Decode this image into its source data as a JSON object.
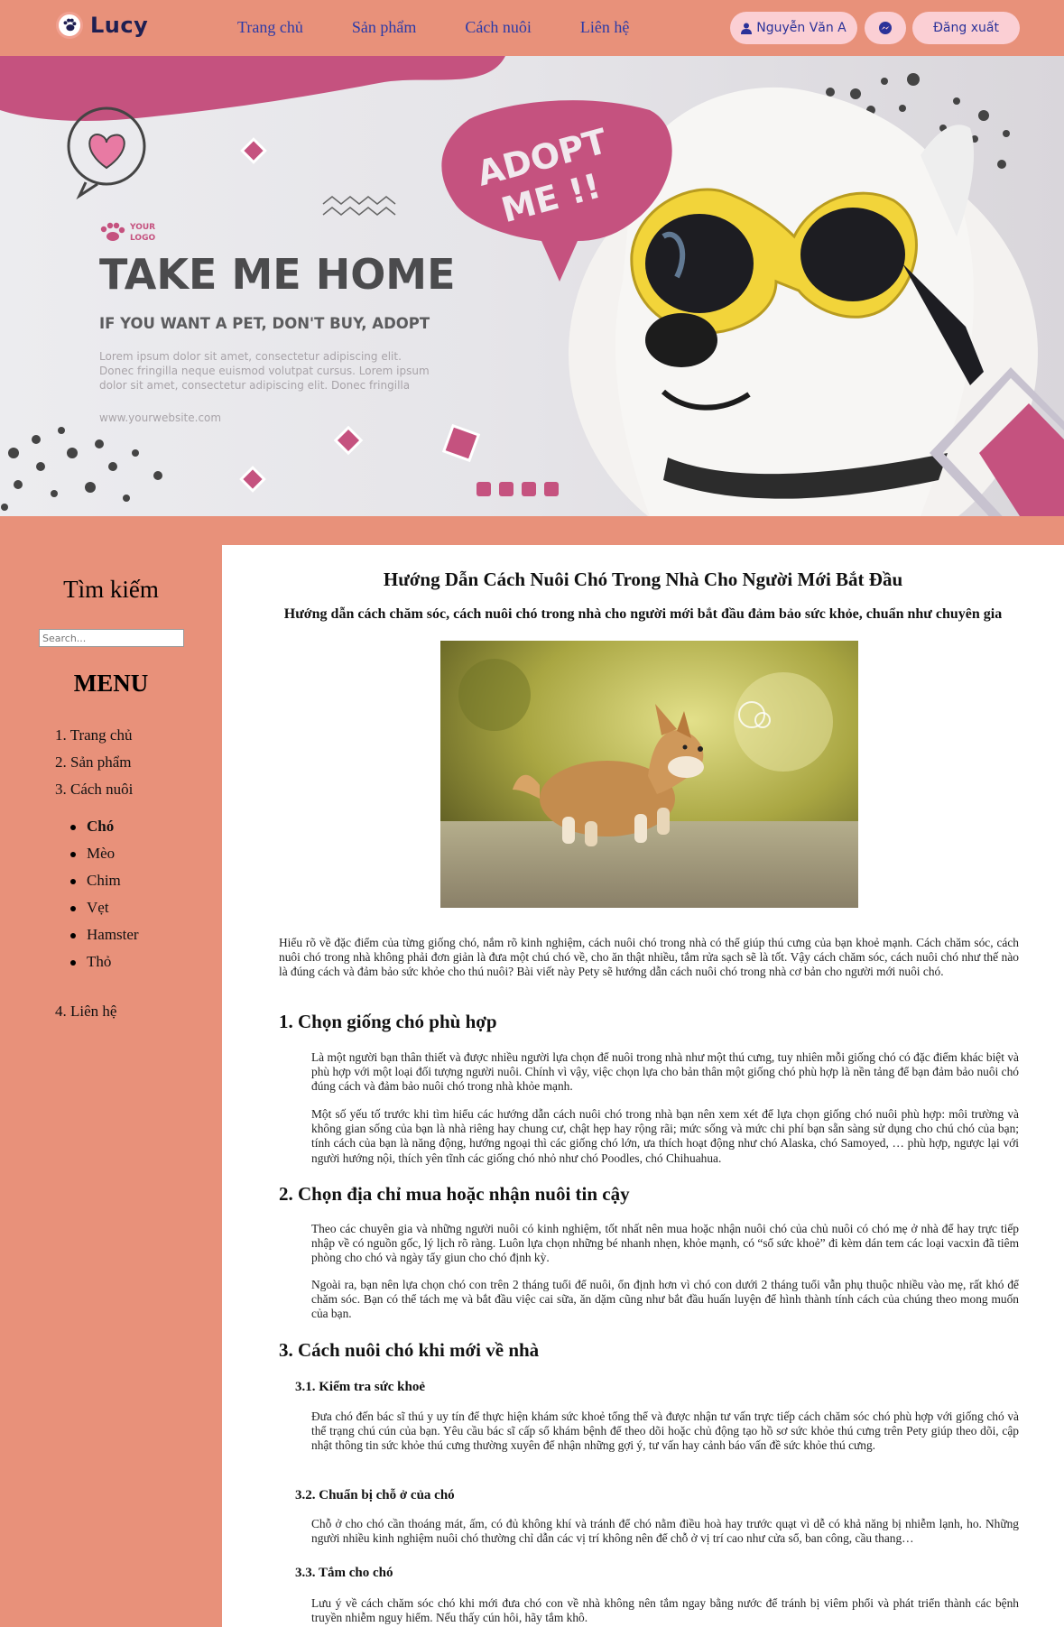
{
  "header": {
    "logo_text": "Lucy",
    "nav": [
      "Trang chủ",
      "Sản phẩm",
      "Cách nuôi",
      "Liên hệ"
    ],
    "user_name": "Nguyễn Văn A",
    "logout_label": "Đăng xuất",
    "icons": {
      "logo": "paw-icon",
      "user": "user-icon",
      "messenger": "messenger-icon"
    }
  },
  "hero": {
    "speech_bubble": [
      "ADOPT",
      "ME !!"
    ],
    "logo_small": [
      "YOUR",
      "LOGO"
    ],
    "headline": "TAKE ME HOME",
    "tagline": "IF YOU WANT A PET, DON'T BUY, ADOPT",
    "lorem": [
      "Lorem ipsum dolor sit amet, consectetur adipiscing elit.",
      "Donec fringilla neque euismod volutpat cursus. Lorem ipsum",
      "dolor sit amet, consectetur adipiscing elit. Donec fringilla"
    ],
    "website": "www.yourwebsite.com"
  },
  "sidebar": {
    "search_title": "Tìm kiếm",
    "search_placeholder": "Search...",
    "menu_title": "MENU",
    "menu_items": [
      "1. Trang chủ",
      "2. Sản phẩm",
      "3. Cách nuôi"
    ],
    "sub_items": [
      "Chó",
      "Mèo",
      "Chim",
      "Vẹt",
      "Hamster",
      "Thỏ"
    ],
    "contact_item": "4. Liên hệ"
  },
  "article": {
    "title": "Hướng Dẫn Cách Nuôi Chó Trong Nhà Cho Người Mới Bắt Đầu",
    "subtitle": "Hướng dẫn cách chăm sóc, cách nuôi chó trong nhà cho người mới bắt đầu đảm bảo sức khỏe, chuẩn như chuyên gia",
    "intro": "Hiểu rõ về đặc điểm của từng giống chó, nắm rõ kinh nghiệm, cách nuôi chó trong nhà có thể giúp thú cưng của bạn khoẻ mạnh. Cách chăm sóc, cách nuôi chó trong nhà không phải đơn giản là đưa một chú chó về, cho ăn thật nhiều, tắm rửa sạch sẽ là tốt. Vậy cách chăm sóc, cách nuôi chó như thế nào là đúng cách và đảm bảo sức khỏe cho thú nuôi? Bài viết này Pety sẽ hướng dẫn cách nuôi chó trong nhà cơ bản cho người mới nuôi chó.",
    "s1_title": "1. Chọn giống chó phù hợp",
    "s1_p1": "Là một người bạn thân thiết và được nhiều người lựa chọn để nuôi trong nhà như một thú cưng, tuy nhiên mỗi giống chó có đặc điểm khác biệt và phù hợp với một loại đối tượng người nuôi. Chính vì vậy, việc chọn lựa cho bản thân một giống chó phù hợp là nền tảng để bạn đảm bảo nuôi chó đúng cách và đảm bảo nuôi chó trong nhà khỏe mạnh.",
    "s1_p2": "Một số yếu tố trước khi tìm hiểu các hướng dẫn cách nuôi chó trong nhà bạn nên xem xét để lựa chọn giống chó nuôi phù hợp: môi trường và không gian sống của bạn là nhà riêng hay chung cư, chật hẹp hay rộng rãi; mức sống và mức chi phí bạn sẵn sàng sử dụng cho chú chó của bạn; tính cách của bạn là năng động, hướng ngoại thì các giống chó lớn, ưa thích hoạt động như chó Alaska, chó Samoyed, … phù hợp, ngược lại với người hướng nội, thích yên tĩnh các giống chó nhỏ như chó Poodles, chó Chihuahua.",
    "s2_title": "2. Chọn địa chỉ mua hoặc nhận nuôi tin cậy",
    "s2_p1": "Theo các chuyên gia và những người nuôi có kinh nghiệm, tốt nhất nên mua hoặc nhận nuôi chó của chủ nuôi có chó mẹ ở nhà để hay trực tiếp nhập về có nguồn gốc, lý lịch rõ ràng. Luôn lựa chọn những bé nhanh nhẹn, khỏe mạnh, có “sổ sức khoẻ” đi kèm dán tem các loại vacxin đã tiêm phòng cho chó và ngày tẩy giun cho chó định kỳ.",
    "s2_p2": "Ngoài ra, bạn nên lựa chọn chó con trên 2 tháng tuổi để nuôi, ổn định hơn vì chó con dưới 2 tháng tuổi vẫn phụ thuộc nhiều vào mẹ, rất khó để chăm sóc. Bạn có thể tách mẹ và bắt đầu việc cai sữa, ăn dặm cũng như bắt đầu huấn luyện để hình thành tính cách của chúng theo mong muốn của bạn.",
    "s3_title": "3. Cách nuôi chó khi mới về nhà",
    "s31_title": "3.1. Kiểm tra sức khoẻ",
    "s31_p": "Đưa chó đến bác sĩ thú y uy tín để thực hiện khám sức khoẻ tổng thể và được nhận tư vấn trực tiếp cách chăm sóc chó phù hợp với giống chó và thể trạng chú cún của bạn. Yêu cầu bác sĩ cấp sổ khám bệnh để theo dõi hoặc chủ động tạo hồ sơ sức khỏe thú cưng trên Pety giúp theo dõi, cập nhật thông tin sức khỏe thú cưng thường xuyên để nhận những gợi ý, tư vấn hay cảnh báo vấn đề sức khỏe thú cưng.",
    "s32_title": "3.2. Chuẩn bị chỗ ở của chó",
    "s32_p": "Chỗ ở cho chó cần thoáng mát, ấm, có đủ không khí và tránh để chó nằm điều hoà hay trước quạt vì dễ có khả năng bị nhiễm lạnh, ho. Những người nhiều kinh nghiệm nuôi chó thường chỉ dẫn các vị trí không nên để chỗ ở vị trí cao như cửa sổ, ban công, cầu thang…",
    "s33_title": "3.3. Tắm cho chó",
    "s33_p": "Lưu ý về cách chăm sóc chó khi mới đưa chó con về nhà không nên tắm ngay bằng nước để tránh bị viêm phổi và phát triển thành các bệnh truyền nhiễm nguy hiểm. Nếu thấy cún hôi, hãy tắm khô."
  },
  "colors": {
    "brand_salmon": "#e8917a",
    "pill_pink": "#fbcfd4",
    "hero_magenta": "#c5527f",
    "logo_navy": "#1e1f52"
  }
}
